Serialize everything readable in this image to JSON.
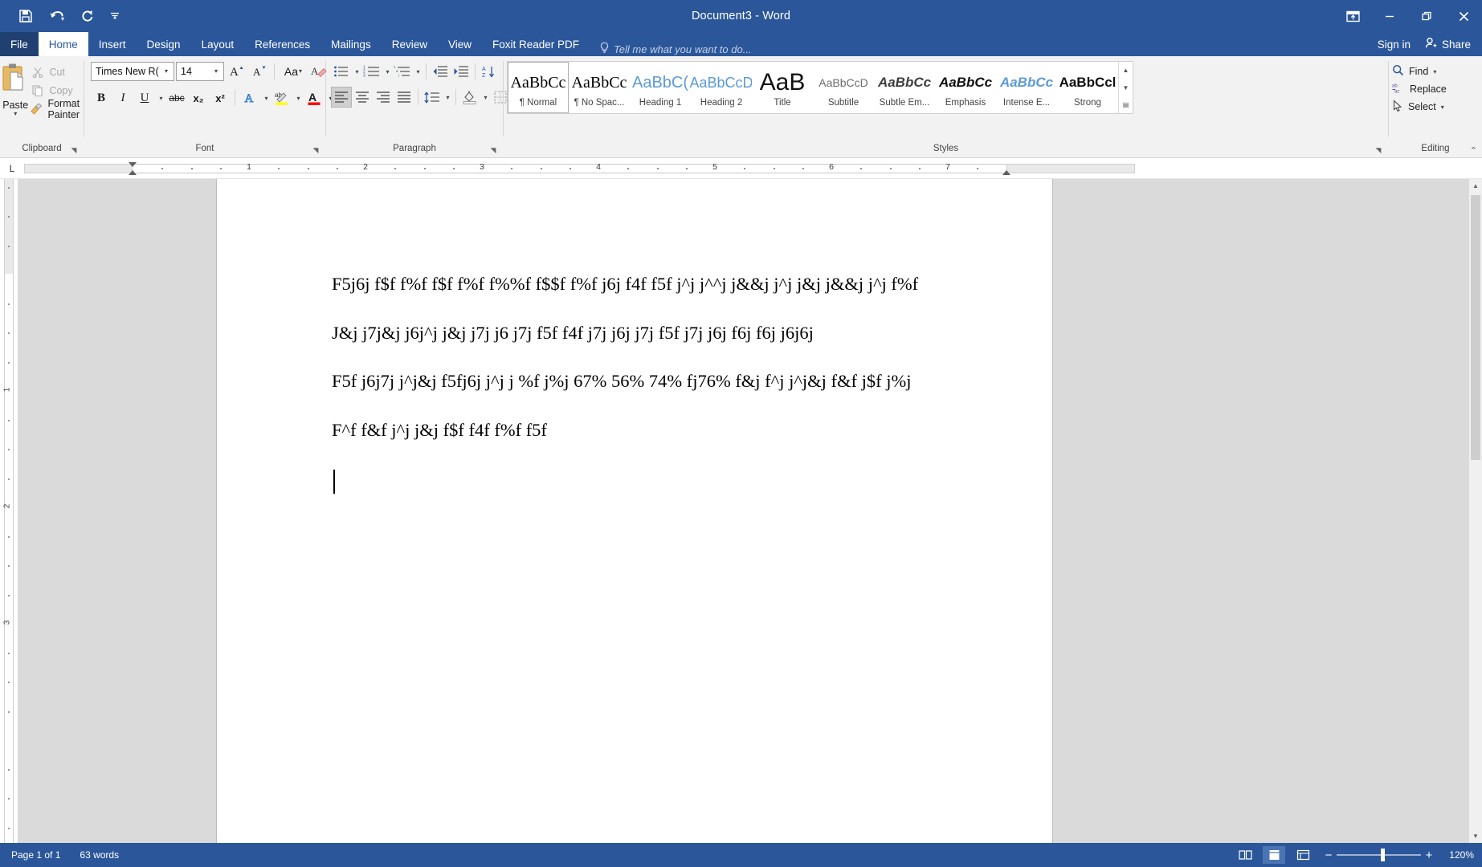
{
  "titlebar": {
    "document_title": "Document3 - Word",
    "quick_access": [
      {
        "name": "save-icon",
        "label": "Save"
      },
      {
        "name": "undo-icon",
        "label": "Undo"
      },
      {
        "name": "redo-icon",
        "label": "Repeat"
      },
      {
        "name": "customize-qat-icon",
        "label": "Customize Quick Access Toolbar"
      }
    ],
    "ribbon_display_options": "Ribbon Display Options",
    "minimize": "Minimize",
    "restore": "Restore Down",
    "close": "Close"
  },
  "tabs": [
    {
      "label": "File",
      "active": false,
      "file": true
    },
    {
      "label": "Home",
      "active": true,
      "file": false
    },
    {
      "label": "Insert",
      "active": false,
      "file": false
    },
    {
      "label": "Design",
      "active": false,
      "file": false
    },
    {
      "label": "Layout",
      "active": false,
      "file": false
    },
    {
      "label": "References",
      "active": false,
      "file": false
    },
    {
      "label": "Mailings",
      "active": false,
      "file": false
    },
    {
      "label": "Review",
      "active": false,
      "file": false
    },
    {
      "label": "View",
      "active": false,
      "file": false
    },
    {
      "label": "Foxit Reader PDF",
      "active": false,
      "file": false
    }
  ],
  "tell_me": "Tell me what you want to do...",
  "account": {
    "sign_in": "Sign in",
    "share": "Share"
  },
  "ribbon": {
    "clipboard": {
      "group_label": "Clipboard",
      "paste_label": "Paste",
      "cut_label": "Cut",
      "copy_label": "Copy",
      "format_painter_label": "Format Painter"
    },
    "font": {
      "group_label": "Font",
      "font_name": "Times New R(",
      "font_name_full": "Times New Roman",
      "font_size": "14",
      "grow_font": "Increase Font Size",
      "shrink_font": "Decrease Font Size",
      "change_case": "Aa",
      "clear_formatting": "Clear All Formatting",
      "bold": "B",
      "italic": "I",
      "underline": "U",
      "strikethrough": "abc",
      "subscript": "x₂",
      "superscript": "x²",
      "text_effects": "A",
      "highlight": "Text Highlight Color",
      "font_color": "A",
      "highlight_color": "#ffff00",
      "font_color_value": "#ff0000"
    },
    "paragraph": {
      "group_label": "Paragraph",
      "bullets": "Bullets",
      "numbering": "Numbering",
      "multilevel": "Multilevel List",
      "decrease_indent": "Decrease Indent",
      "increase_indent": "Increase Indent",
      "sort": "Sort",
      "show_marks": "¶",
      "align_left": "Align Left",
      "align_center": "Center",
      "align_right": "Align Right",
      "justify": "Justify",
      "line_spacing": "Line and Paragraph Spacing",
      "shading": "Shading",
      "borders": "Borders"
    },
    "styles": {
      "group_label": "Styles",
      "items": [
        {
          "preview": "AaBbCc",
          "name": "¶ Normal",
          "selected": true,
          "cls": "sp-normal"
        },
        {
          "preview": "AaBbCc",
          "name": "¶ No Spac...",
          "selected": false,
          "cls": "sp-nospace"
        },
        {
          "preview": "AaBbC(",
          "name": "Heading 1",
          "selected": false,
          "cls": "sp-h1"
        },
        {
          "preview": "AaBbCcD",
          "name": "Heading 2",
          "selected": false,
          "cls": "sp-h2"
        },
        {
          "preview": "AaB",
          "name": "Title",
          "selected": false,
          "cls": "sp-title"
        },
        {
          "preview": "AaBbCcD",
          "name": "Subtitle",
          "selected": false,
          "cls": "sp-subtitle"
        },
        {
          "preview": "AaBbCc",
          "name": "Subtle Em...",
          "selected": false,
          "cls": "sp-subem"
        },
        {
          "preview": "AaBbCc",
          "name": "Emphasis",
          "selected": false,
          "cls": "sp-em"
        },
        {
          "preview": "AaBbCc",
          "name": "Intense E...",
          "selected": false,
          "cls": "sp-iem"
        },
        {
          "preview": "AaBbCcl",
          "name": "Strong",
          "selected": false,
          "cls": "sp-strong"
        }
      ]
    },
    "editing": {
      "group_label": "Editing",
      "find": "Find",
      "replace": "Replace",
      "select": "Select"
    }
  },
  "ruler": {
    "tab_selector": "L",
    "h_marks": [
      "1",
      "2",
      "3",
      "4",
      "5",
      "6",
      "7"
    ],
    "v_marks": [
      "1",
      "2",
      "3"
    ]
  },
  "document": {
    "paragraphs": [
      "F5j6j f$f f%f f$f f%f f%%f f$$f f%f j6j f4f f5f j^j j^^j j&&j j^j j&j j&&j j^j f%f",
      "J&j j7j&j j6j^j j&j j7j j6 j7j f5f f4f j7j j6j j7j f5f j7j j6j f6j f6j j6j6j",
      "F5f j6j7j j^j&j f5fj6j j^j j %f j%j 67% 56% 74% fj76% f&j f^j j^j&j f&f j$f j%j",
      "F^f f&f j^j j&j f$f f4f f%f f5f"
    ]
  },
  "statusbar": {
    "page_info": "Page 1 of 1",
    "word_count": "63 words",
    "read_mode": "Read Mode",
    "print_layout": "Print Layout",
    "web_layout": "Web Layout",
    "zoom_out": "−",
    "zoom_in": "+",
    "zoom_level": "120%"
  },
  "colors": {
    "word_blue": "#2b579a",
    "ribbon_bg": "#f2f2f2",
    "page_bg": "#dadada",
    "accent_icon": "#2b579a"
  }
}
